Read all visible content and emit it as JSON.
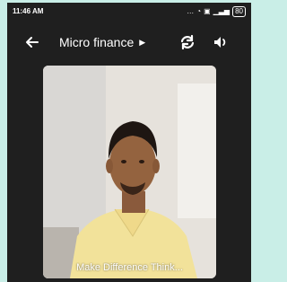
{
  "status_bar": {
    "time": "11:46 AM",
    "battery": "80"
  },
  "header": {
    "title": "Micro finance",
    "icons": [
      "back-arrow-icon",
      "chevron-right-icon",
      "sync-icon",
      "volume-icon"
    ]
  },
  "video": {
    "caption": "Make Difference Think..."
  },
  "colors": {
    "background": "#c9eee7",
    "app_background": "#1f1f1f",
    "text": "#ffffff",
    "shirt": "#f2e29a"
  }
}
